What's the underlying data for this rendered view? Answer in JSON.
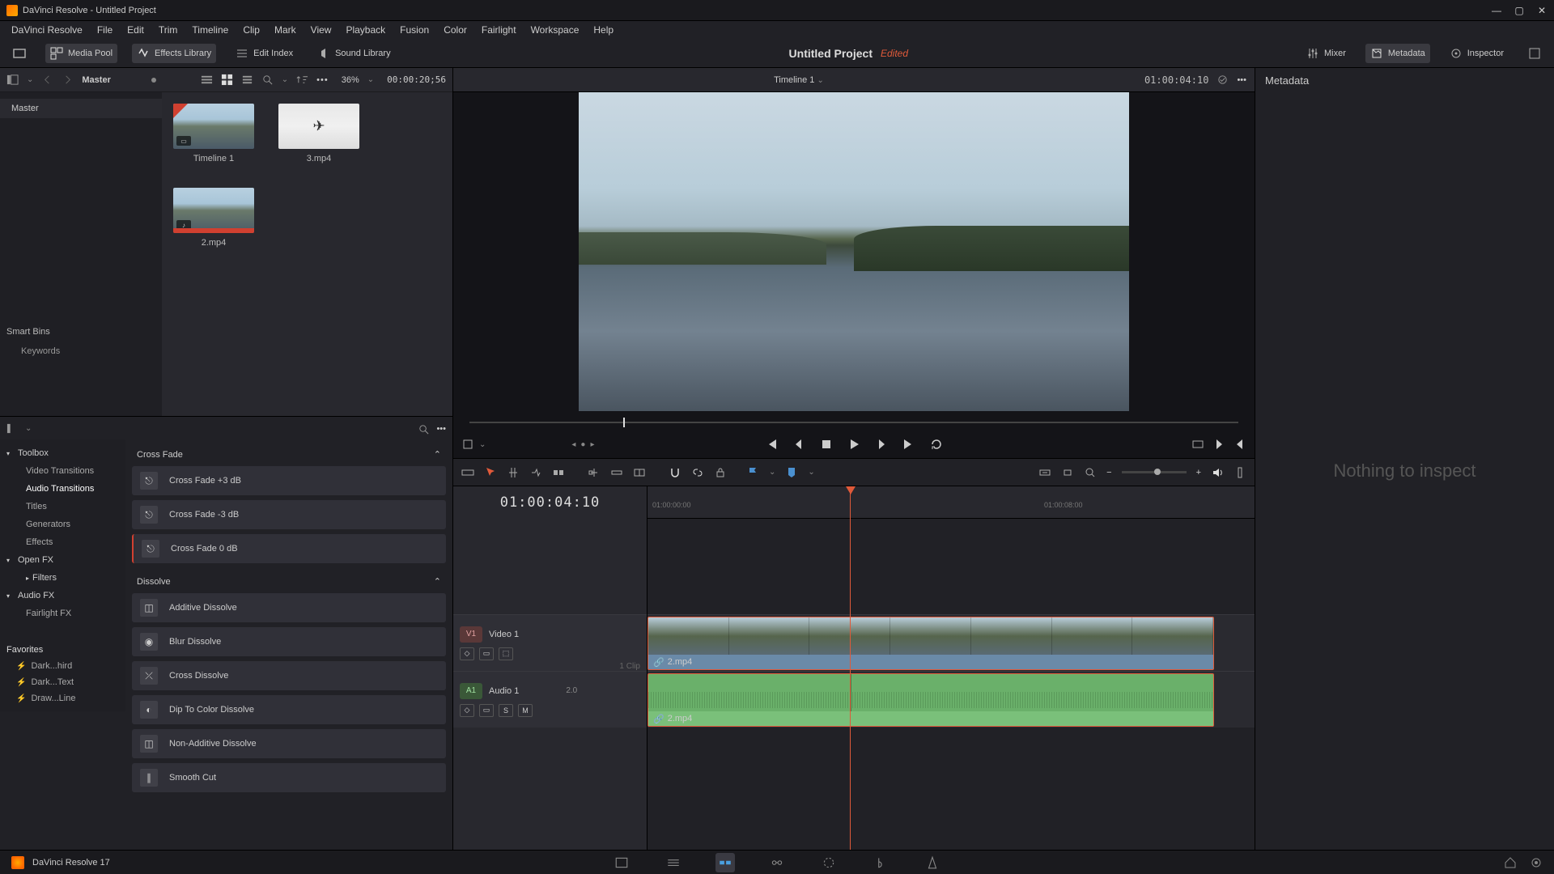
{
  "window": {
    "title": "DaVinci Resolve - Untitled Project"
  },
  "menus": [
    "DaVinci Resolve",
    "File",
    "Edit",
    "Trim",
    "Timeline",
    "Clip",
    "Mark",
    "View",
    "Playback",
    "Fusion",
    "Color",
    "Fairlight",
    "Workspace",
    "Help"
  ],
  "toolbar": {
    "media_pool": "Media Pool",
    "effects_library": "Effects Library",
    "edit_index": "Edit Index",
    "sound_library": "Sound Library",
    "project_title": "Untitled Project",
    "edited_label": "Edited",
    "mixer": "Mixer",
    "metadata": "Metadata",
    "inspector": "Inspector"
  },
  "media_pool": {
    "bin_label": "Master",
    "zoom": "36%",
    "source_tc": "00:00:20;56",
    "bins": {
      "master": "Master",
      "smart_label": "Smart Bins",
      "keywords": "Keywords"
    },
    "clips": [
      {
        "name": "Timeline 1",
        "type": "timeline"
      },
      {
        "name": "3.mp4",
        "type": "video"
      },
      {
        "name": "2.mp4",
        "type": "av"
      }
    ]
  },
  "effects": {
    "toolbox": "Toolbox",
    "tree": {
      "video_transitions": "Video Transitions",
      "audio_transitions": "Audio Transitions",
      "titles": "Titles",
      "generators": "Generators",
      "effects": "Effects",
      "openfx": "Open FX",
      "filters": "Filters",
      "audiofx": "Audio FX",
      "fairlightfx": "Fairlight FX"
    },
    "groups": [
      {
        "name": "Cross Fade",
        "items": [
          "Cross Fade +3 dB",
          "Cross Fade -3 dB",
          "Cross Fade 0 dB"
        ]
      },
      {
        "name": "Dissolve",
        "items": [
          "Additive Dissolve",
          "Blur Dissolve",
          "Cross Dissolve",
          "Dip To Color Dissolve",
          "Non-Additive Dissolve",
          "Smooth Cut"
        ]
      }
    ],
    "favorites_label": "Favorites",
    "favorites": [
      "Dark...hird",
      "Dark...Text",
      "Draw...Line"
    ]
  },
  "viewer": {
    "timeline_label": "Timeline 1",
    "record_tc": "01:00:04:10"
  },
  "timeline": {
    "tc": "01:00:04:10",
    "ruler": [
      "01:00:00:00",
      "01:00:08:00"
    ],
    "video_track": {
      "tag": "V1",
      "name": "Video 1",
      "clip_count": "1 Clip",
      "clip_label": "2.mp4"
    },
    "audio_track": {
      "tag": "A1",
      "name": "Audio 1",
      "ch": "2.0",
      "clip_label": "2.mp4"
    }
  },
  "metadata_panel": {
    "header": "Metadata",
    "empty": "Nothing to inspect"
  },
  "footer": {
    "app": "DaVinci Resolve 17"
  }
}
